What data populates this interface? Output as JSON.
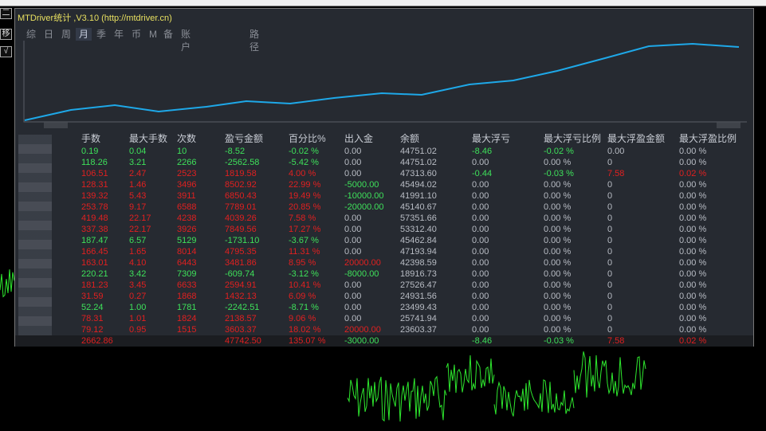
{
  "window": {
    "title": "MTDriver统计 ,V3.10 (http://mtdriver.cn)"
  },
  "side_buttons": [
    "二",
    "移",
    "√"
  ],
  "tabs": [
    {
      "label": "综"
    },
    {
      "label": "日"
    },
    {
      "label": "周"
    },
    {
      "label": "月",
      "active": true
    },
    {
      "label": "季"
    },
    {
      "label": "年"
    },
    {
      "label": "币"
    },
    {
      "label": "M"
    },
    {
      "label": "备"
    },
    {
      "label": "账户"
    },
    {
      "label": "路径"
    }
  ],
  "table": {
    "headers": [
      "手数",
      "最大手数",
      "次数",
      "盈亏金额",
      "百分比%",
      "出入金",
      "余额",
      "最大浮亏",
      "最大浮亏比例",
      "最大浮盈金额",
      "最大浮盈比例"
    ],
    "rows": [
      [
        "0.19",
        "0.04",
        "10",
        "-8.52",
        "-0.02 %",
        "0.00",
        "44751.02",
        "-8.46",
        "-0.02 %",
        "0.00",
        "0.00 %"
      ],
      [
        "118.26",
        "3.21",
        "2266",
        "-2562.58",
        "-5.42 %",
        "0.00",
        "44751.02",
        "0.00",
        "0.00 %",
        "0",
        "0.00 %"
      ],
      [
        "106.51",
        "2.47",
        "2523",
        "1819.58",
        "4.00 %",
        "0.00",
        "47313.60",
        "-0.44",
        "-0.03 %",
        "7.58",
        "0.02 %"
      ],
      [
        "128.31",
        "1.46",
        "3496",
        "8502.92",
        "22.99 %",
        "-5000.00",
        "45494.02",
        "0.00",
        "0.00 %",
        "0",
        "0.00 %"
      ],
      [
        "139.32",
        "5.43",
        "3911",
        "6850.43",
        "19.49 %",
        "-10000.00",
        "41991.10",
        "0.00",
        "0.00 %",
        "0",
        "0.00 %"
      ],
      [
        "253.78",
        "9.17",
        "6588",
        "7789.01",
        "20.85 %",
        "-20000.00",
        "45140.67",
        "0.00",
        "0.00 %",
        "0",
        "0.00 %"
      ],
      [
        "419.48",
        "22.17",
        "4238",
        "4039.26",
        "7.58 %",
        "0.00",
        "57351.66",
        "0.00",
        "0.00 %",
        "0",
        "0.00 %"
      ],
      [
        "337.38",
        "22.17",
        "3926",
        "7849.56",
        "17.27 %",
        "0.00",
        "53312.40",
        "0.00",
        "0.00 %",
        "0",
        "0.00 %"
      ],
      [
        "187.47",
        "6.57",
        "5129",
        "-1731.10",
        "-3.67 %",
        "0.00",
        "45462.84",
        "0.00",
        "0.00 %",
        "0",
        "0.00 %"
      ],
      [
        "166.45",
        "1.65",
        "8014",
        "4795.35",
        "11.31 %",
        "0.00",
        "47193.94",
        "0.00",
        "0.00 %",
        "0",
        "0.00 %"
      ],
      [
        "163.01",
        "4.10",
        "6443",
        "3481.86",
        "8.95 %",
        "20000.00",
        "42398.59",
        "0.00",
        "0.00 %",
        "0",
        "0.00 %"
      ],
      [
        "220.21",
        "3.42",
        "7309",
        "-609.74",
        "-3.12 %",
        "-8000.00",
        "18916.73",
        "0.00",
        "0.00 %",
        "0",
        "0.00 %"
      ],
      [
        "181.23",
        "3.45",
        "6633",
        "2594.91",
        "10.41 %",
        "0.00",
        "27526.47",
        "0.00",
        "0.00 %",
        "0",
        "0.00 %"
      ],
      [
        "31.59",
        "0.27",
        "1868",
        "1432.13",
        "6.09 %",
        "0.00",
        "24931.56",
        "0.00",
        "0.00 %",
        "0",
        "0.00 %"
      ],
      [
        "52.24",
        "1.00",
        "1781",
        "-2242.51",
        "-8.71 %",
        "0.00",
        "23499.43",
        "0.00",
        "0.00 %",
        "0",
        "0.00 %"
      ],
      [
        "78.31",
        "1.01",
        "1824",
        "2138.57",
        "9.06 %",
        "0.00",
        "25741.94",
        "0.00",
        "0.00 %",
        "0",
        "0.00 %"
      ],
      [
        "79.12",
        "0.95",
        "1515",
        "3603.37",
        "18.02 %",
        "20000.00",
        "23603.37",
        "0.00",
        "0.00 %",
        "0",
        "0.00 %"
      ]
    ],
    "total": [
      "2662.86",
      "",
      "",
      "47742.50",
      "135.07 %",
      "-3000.00",
      "",
      "-8.46",
      "-0.03 %",
      "7.58",
      "0.02 %"
    ]
  },
  "colors": {
    "gain": "#e02020",
    "loss": "#3ee05a",
    "neutral": "#b8bcc4",
    "title": "#e8e060",
    "equity_line": "#1ea8e8"
  }
}
